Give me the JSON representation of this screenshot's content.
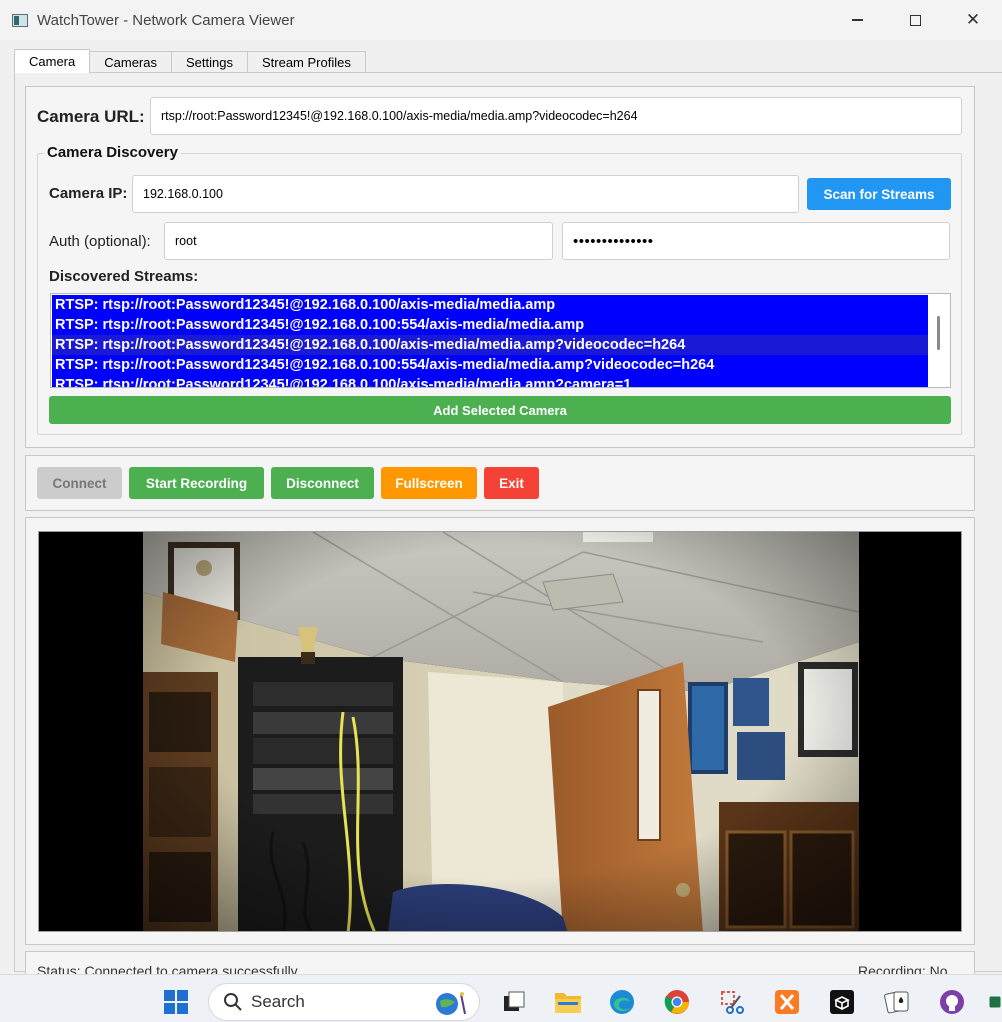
{
  "window": {
    "title": "WatchTower - Network Camera Viewer",
    "minimize_symbol": "—",
    "maximize_symbol": "☐",
    "close_symbol": "✕"
  },
  "tabs": [
    {
      "label": "Camera",
      "active": true
    },
    {
      "label": "Cameras",
      "active": false
    },
    {
      "label": "Settings",
      "active": false
    },
    {
      "label": "Stream Profiles",
      "active": false
    }
  ],
  "camera": {
    "url_label": "Camera URL:",
    "url_value": "rtsp://root:Password12345!@192.168.0.100/axis-media/media.amp?videocodec=h264"
  },
  "discovery": {
    "title": "Camera Discovery",
    "ip_label": "Camera IP:",
    "ip_value": "192.168.0.100",
    "scan_button": "Scan for Streams",
    "auth_label": "Auth (optional):",
    "user_value": "root",
    "password_mask": "••••••••••••••",
    "streams_label": "Discovered Streams:",
    "streams": [
      "RTSP: rtsp://root:Password12345!@192.168.0.100/axis-media/media.amp",
      "RTSP: rtsp://root:Password12345!@192.168.0.100:554/axis-media/media.amp",
      "RTSP: rtsp://root:Password12345!@192.168.0.100/axis-media/media.amp?videocodec=h264",
      "RTSP: rtsp://root:Password12345!@192.168.0.100:554/axis-media/media.amp?videocodec=h264",
      "RTSP: rtsp://root:Password12345!@192.168.0.100/axis-media/media.amp?camera=1"
    ],
    "add_button": "Add Selected Camera"
  },
  "controls": {
    "connect": "Connect",
    "start_recording": "Start Recording",
    "disconnect": "Disconnect",
    "fullscreen": "Fullscreen",
    "exit": "Exit"
  },
  "status": {
    "left": "Status: Connected to camera successfully",
    "right": "Recording: No"
  },
  "taskbar": {
    "search_label": "Search"
  },
  "colors": {
    "scan_button": "#2196f3",
    "green": "#4caf50",
    "orange": "#ff9800",
    "red": "#f44336",
    "disabled": "#cccccc",
    "selection": "#0000ff"
  }
}
